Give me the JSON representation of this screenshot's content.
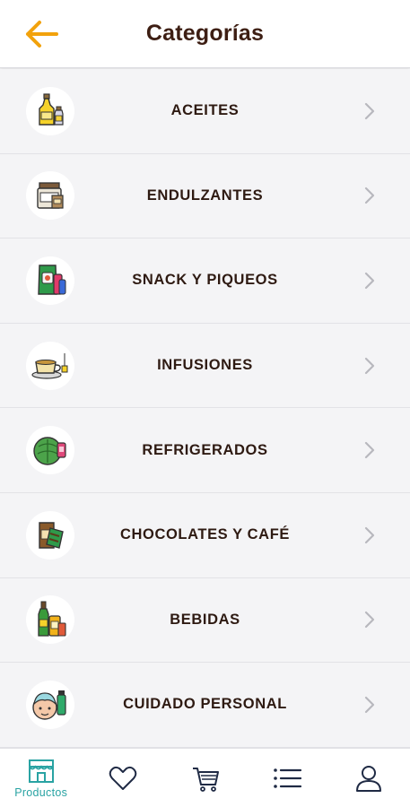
{
  "header": {
    "title": "Categorías",
    "back_icon": "arrow-left-icon",
    "accent": "#f2a20c"
  },
  "categories": [
    {
      "label": "ACEITES",
      "icon": "oil-bottles-icon"
    },
    {
      "label": "ENDULZANTES",
      "icon": "jars-icon"
    },
    {
      "label": "SNACK Y PIQUEOS",
      "icon": "snack-bags-icon"
    },
    {
      "label": "INFUSIONES",
      "icon": "teacup-icon"
    },
    {
      "label": "REFRIGERADOS",
      "icon": "cabbage-icon"
    },
    {
      "label": "CHOCOLATES Y CAFÉ",
      "icon": "chocolate-coffee-icon"
    },
    {
      "label": "BEBIDAS",
      "icon": "bottles-icon"
    },
    {
      "label": "CUIDADO PERSONAL",
      "icon": "personal-care-icon"
    }
  ],
  "bottom_nav": {
    "items": [
      {
        "icon": "store-icon",
        "label": "Productos",
        "active": true
      },
      {
        "icon": "heart-icon",
        "label": ""
      },
      {
        "icon": "cart-icon",
        "label": ""
      },
      {
        "icon": "list-icon",
        "label": ""
      },
      {
        "icon": "user-icon",
        "label": ""
      }
    ],
    "active_color": "#29a3a3",
    "inactive_color": "#1f2a44"
  }
}
